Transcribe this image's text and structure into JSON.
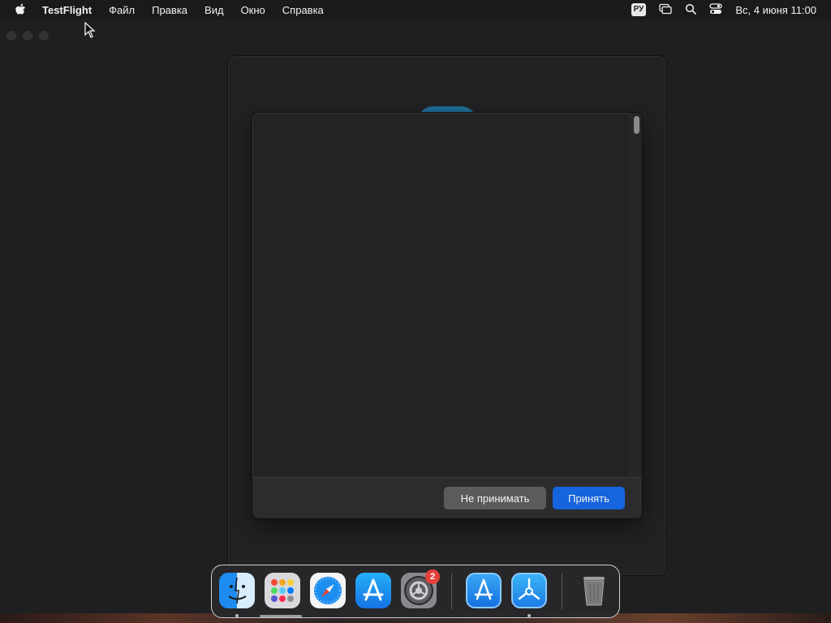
{
  "menubar": {
    "app_name": "TestFlight",
    "items": [
      "Файл",
      "Правка",
      "Вид",
      "Окно",
      "Справка"
    ],
    "lang_badge": "РУ",
    "clock": "Вс, 4 июня  11:00",
    "icons": [
      "apple-icon",
      "screen-mirroring-icon",
      "search-icon",
      "control-center-icon"
    ]
  },
  "dialog": {
    "decline_label": "Не принимать",
    "accept_label": "Принять"
  },
  "dock": {
    "apps": [
      "finder-icon",
      "launchpad-icon",
      "safari-icon",
      "app-store-icon",
      "system-settings-icon",
      "xcode-app-store-icon",
      "testflight-icon",
      "trash-icon"
    ],
    "settings_badge": "2"
  },
  "colors": {
    "accent": "#1664de",
    "badge": "#e5413a"
  }
}
